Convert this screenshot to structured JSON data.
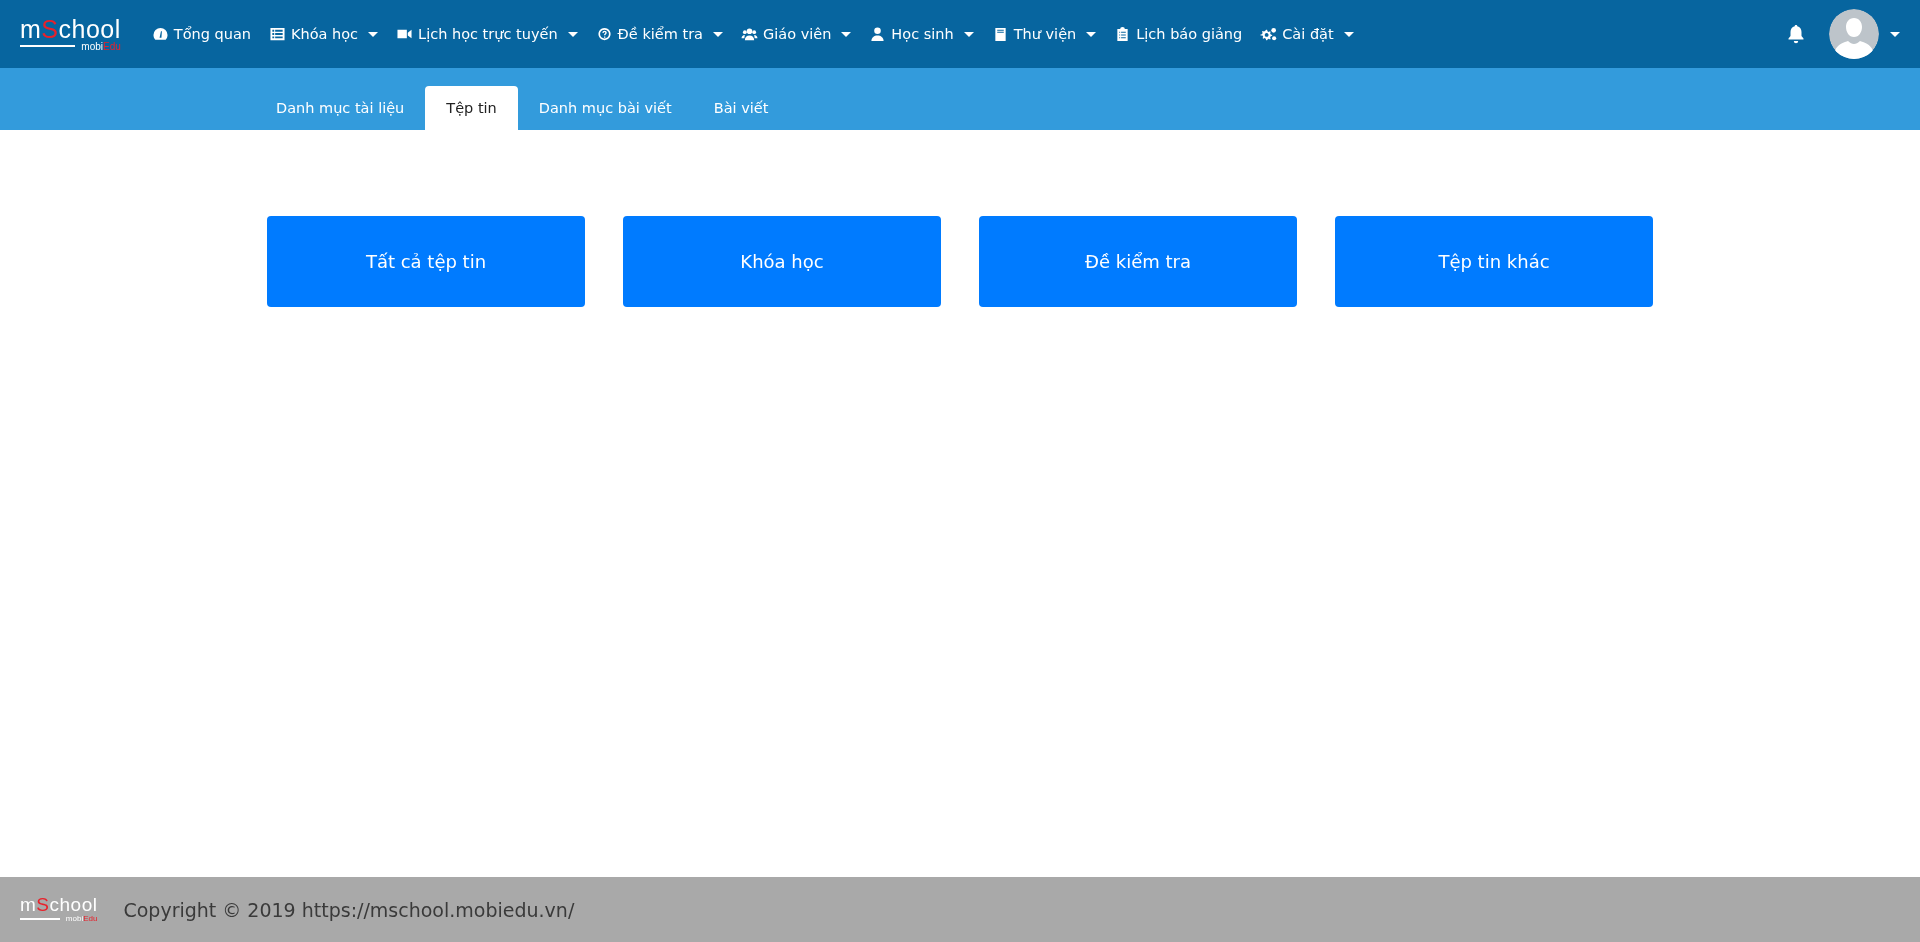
{
  "logo": {
    "top": [
      {
        "text": "m",
        "accent": false
      },
      {
        "text": "S",
        "accent": true
      },
      {
        "text": "chool",
        "accent": false
      }
    ],
    "bottom": [
      {
        "text": "mobi",
        "accent": false
      },
      {
        "text": "Edu",
        "accent": true
      }
    ]
  },
  "nav": [
    {
      "label": "Tổng quan",
      "kind": "gauge",
      "dropdown": false
    },
    {
      "label": "Khóa học",
      "kind": "list",
      "dropdown": true
    },
    {
      "label": "Lịch học trực tuyến",
      "kind": "video",
      "dropdown": true
    },
    {
      "label": "Đề kiểm tra",
      "kind": "question",
      "dropdown": true
    },
    {
      "label": "Giáo viên",
      "kind": "users",
      "dropdown": true
    },
    {
      "label": "Học sinh",
      "kind": "user",
      "dropdown": true
    },
    {
      "label": "Thư viện",
      "kind": "book",
      "dropdown": true
    },
    {
      "label": "Lịch báo giảng",
      "kind": "clipboard",
      "dropdown": false
    },
    {
      "label": "Cài đặt",
      "kind": "cogs",
      "dropdown": true
    }
  ],
  "tabs": [
    {
      "label": "Danh mục tài liệu",
      "selected": false
    },
    {
      "label": "Tệp tin",
      "selected": true
    },
    {
      "label": "Danh mục bài viết",
      "selected": false
    },
    {
      "label": "Bài viết",
      "selected": false
    }
  ],
  "buttons": [
    "Tất cả tệp tin",
    "Khóa học",
    "Đề kiểm tra",
    "Tệp tin khác"
  ],
  "footer": {
    "logo": {
      "top": [
        {
          "text": "m",
          "accent": false
        },
        {
          "text": "S",
          "accent": true
        },
        {
          "text": "chool",
          "accent": false
        }
      ],
      "bottom": [
        {
          "text": "mobi",
          "accent": false
        },
        {
          "text": "Edu",
          "accent": true
        }
      ]
    },
    "copyright": "Copyright © 2019 https://mschool.mobiedu.vn/"
  }
}
